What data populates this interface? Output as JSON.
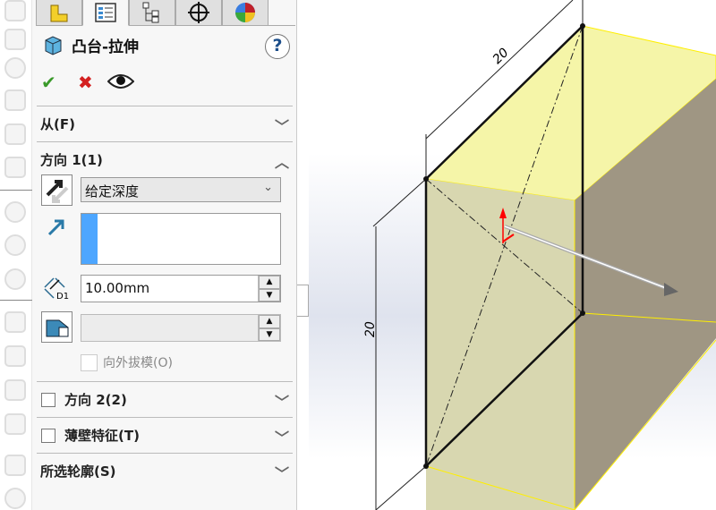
{
  "feature": {
    "title": "凸台-拉伸",
    "help": "?"
  },
  "actions": {
    "ok": "✔",
    "cancel": "✖"
  },
  "tabs": [
    "feature-manager",
    "property-manager",
    "configuration-manager",
    "dimxpert",
    "display-manager"
  ],
  "sections": {
    "from": {
      "label": "从(F)",
      "expanded": false
    },
    "direction1": {
      "label": "方向 1(1)",
      "expanded": true,
      "end_condition": "给定深度",
      "depth": "10.00mm",
      "draft_value": "",
      "draft_outward": {
        "label": "向外拔模(O)",
        "checked": false,
        "enabled": false
      }
    },
    "direction2": {
      "label": "方向 2(2)",
      "checked": false
    },
    "thin_feature": {
      "label": "薄壁特征(T)",
      "checked": false
    },
    "selected_contours": {
      "label": "所选轮廓(S)"
    }
  },
  "viewport": {
    "dim_width": "20",
    "dim_height": "20",
    "depth_label": "D1"
  },
  "colors": {
    "accent": "#4da6ff",
    "face_yellow": "#f5f5a8",
    "face_side": "#9f9683",
    "ok": "#3a9a2a",
    "cancel": "#d42020"
  }
}
